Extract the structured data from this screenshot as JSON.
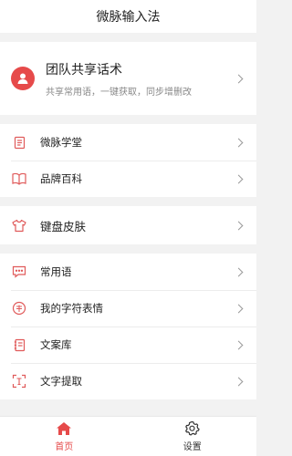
{
  "header": {
    "title": "微脉输入法"
  },
  "team": {
    "title": "团队共享话术",
    "subtitle": "共享常用语，一键获取，同步增删改",
    "icon": "person-circle-icon"
  },
  "group1": [
    {
      "label": "微脉学堂",
      "icon": "document-icon"
    },
    {
      "label": "品牌百科",
      "icon": "open-book-icon"
    }
  ],
  "group2": [
    {
      "label": "键盘皮肤",
      "icon": "tshirt-icon"
    }
  ],
  "group3": [
    {
      "label": "常用语",
      "icon": "chat-bubble-icon"
    },
    {
      "label": "我的字符表情",
      "icon": "emoticon-icon"
    },
    {
      "label": "文案库",
      "icon": "notebook-icon"
    },
    {
      "label": "文字提取",
      "icon": "text-scan-icon"
    }
  ],
  "tabbar": [
    {
      "label": "首页",
      "icon": "home-icon",
      "active": true
    },
    {
      "label": "设置",
      "icon": "gear-icon",
      "active": false
    }
  ],
  "colors": {
    "accent": "#e64a4a",
    "icon_red": "#e05a5a"
  }
}
